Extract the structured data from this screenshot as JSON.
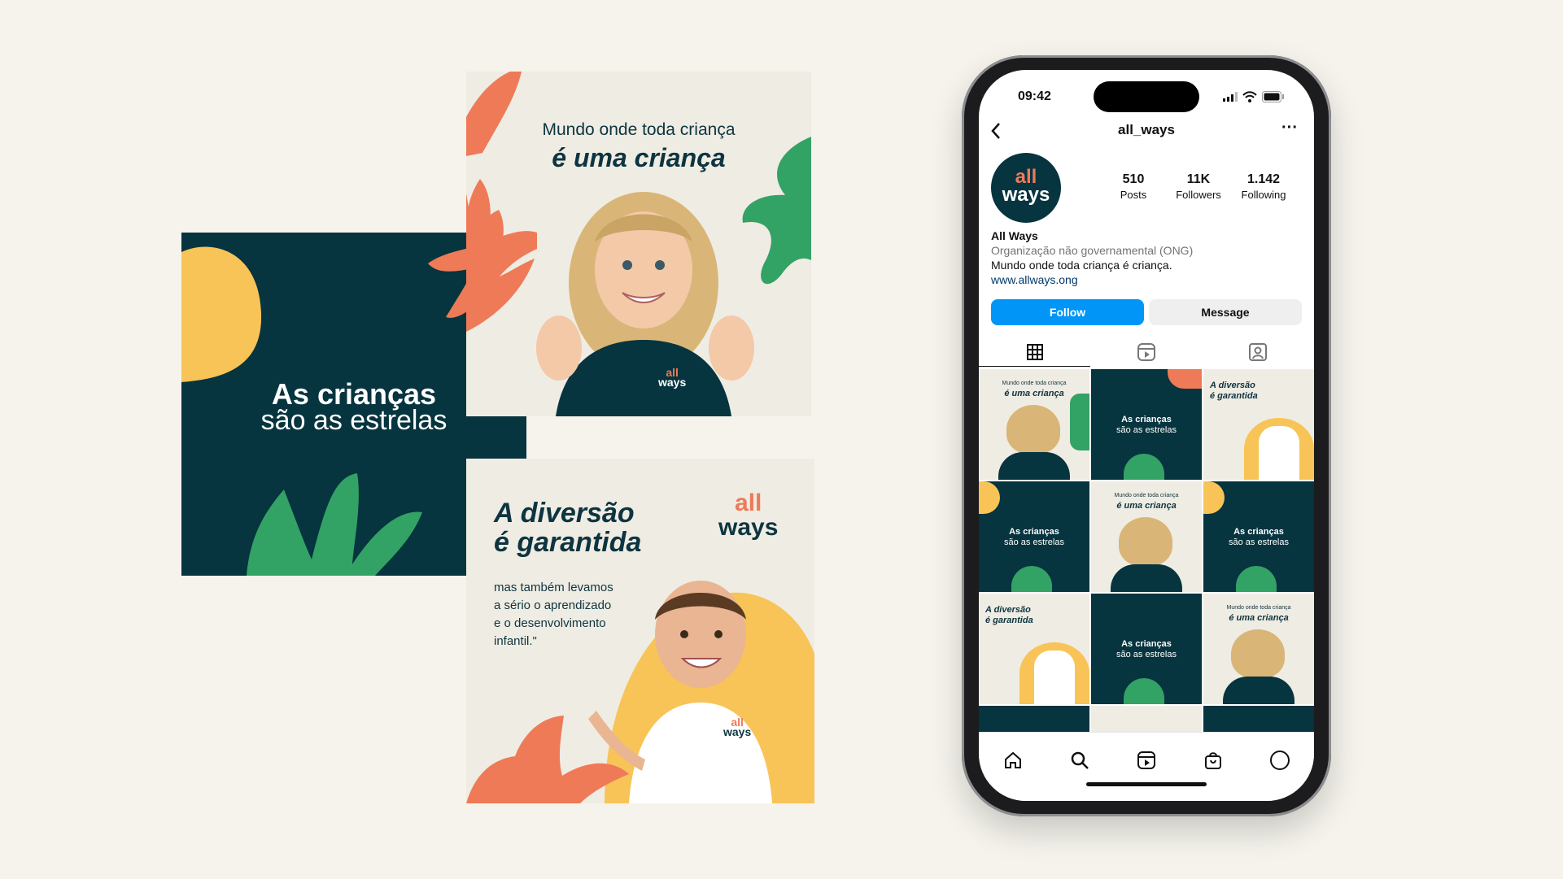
{
  "posts": {
    "p1": {
      "line1": "As crianças",
      "line2": "são as estrelas"
    },
    "p2": {
      "line1": "Mundo onde toda criança",
      "line2": "é uma criança"
    },
    "p3": {
      "title1": "A diversão",
      "title2": "é garantida",
      "body": [
        "mas também levamos",
        "a sério o aprendizado",
        "e o desenvolvimento",
        "infantil.\""
      ]
    }
  },
  "logo": {
    "top": "all",
    "bottom": "ways"
  },
  "phone": {
    "time": "09:42",
    "username": "all_ways",
    "stats": [
      {
        "value": "510",
        "label": "Posts"
      },
      {
        "value": "11K",
        "label": "Followers"
      },
      {
        "value": "1.142",
        "label": "Following"
      }
    ],
    "bio": {
      "name": "All Ways",
      "category": "Organização não governamental (ONG)",
      "text": "Mundo onde toda criança é criança.",
      "link": "www.allways.ong"
    },
    "buttons": {
      "follow": "Follow",
      "message": "Message"
    },
    "grid": {
      "c_line1": "Mundo onde toda criança",
      "c_line2": "é uma criança",
      "a_line1": "As crianças",
      "a_line2": "são as estrelas",
      "b_line1": "A diversão",
      "b_line2": "é garantida"
    }
  },
  "colors": {
    "dark": "#06343f",
    "cream": "#efece3",
    "orange": "#ee7a58",
    "green": "#33a265",
    "yellow": "#f8c457",
    "ig_blue": "#0095f6"
  },
  "icons": [
    "back-chevron-icon",
    "more-dots-icon",
    "grid-icon",
    "reels-tab-icon",
    "tagged-icon",
    "home-icon",
    "search-icon",
    "reels-icon",
    "shop-icon",
    "profile-icon",
    "signal-icon",
    "wifi-icon",
    "battery-icon"
  ]
}
